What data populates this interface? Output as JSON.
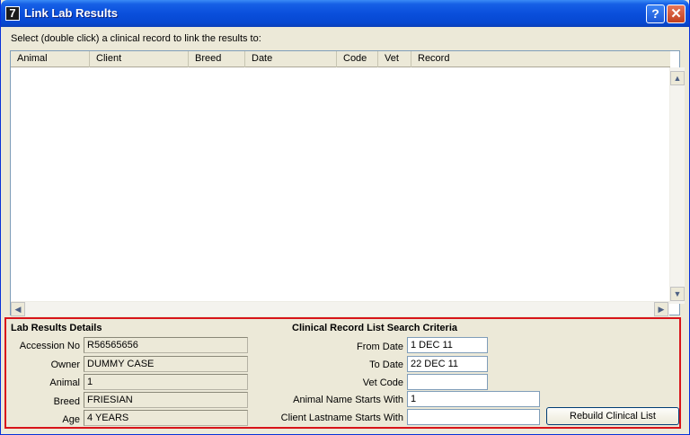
{
  "window": {
    "icon_glyph": "7",
    "title": "Link Lab Results",
    "help_glyph": "?",
    "close_glyph": "✕"
  },
  "instruction": "Select (double click) a clinical record to link the results to:",
  "list": {
    "columns": [
      "Animal",
      "Client",
      "Breed",
      "Date",
      "Code",
      "Vet",
      "Record"
    ],
    "rows": []
  },
  "scroll_glyphs": {
    "up": "▲",
    "down": "▼",
    "left": "◀",
    "right": "▶"
  },
  "lab_details": {
    "title": "Lab Results Details",
    "fields": [
      {
        "label": "Accession No",
        "value": "R56565656"
      },
      {
        "label": "Owner",
        "value": "DUMMY CASE"
      },
      {
        "label": "Animal",
        "value": "1"
      },
      {
        "label": "Breed",
        "value": "FRIESIAN"
      },
      {
        "label": "Age",
        "value": "4 YEARS"
      }
    ]
  },
  "search": {
    "title": "Clinical Record List Search Criteria",
    "from_date": {
      "label": "From Date",
      "value": "1 DEC 11"
    },
    "to_date": {
      "label": "To Date",
      "value": "22 DEC 11"
    },
    "vet_code": {
      "label": "Vet Code",
      "value": ""
    },
    "animal_name": {
      "label": "Animal Name Starts With",
      "value": "1"
    },
    "client_lastname": {
      "label": "Client Lastname Starts With",
      "value": ""
    },
    "rebuild_label": "Rebuild Clinical List"
  }
}
